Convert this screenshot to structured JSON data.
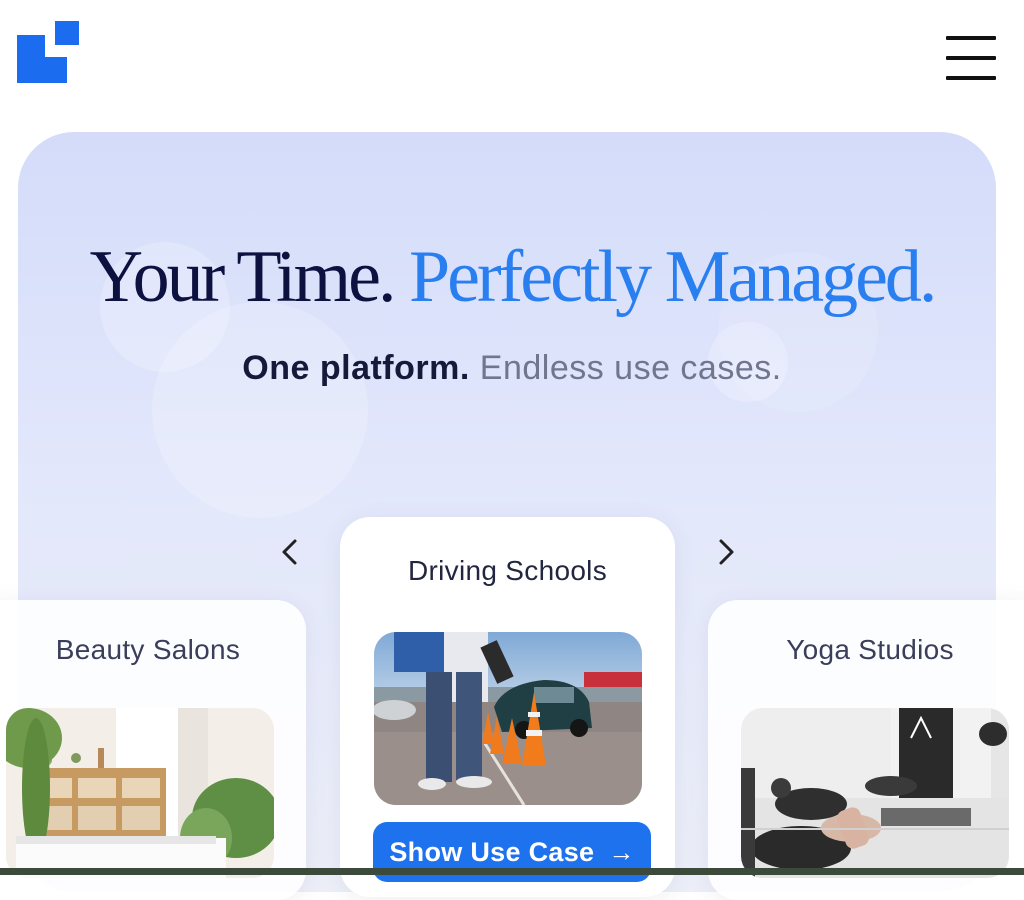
{
  "header": {
    "logo": "logo-icon",
    "menu": "hamburger-menu-icon"
  },
  "hero": {
    "headline_dark": "Your Time.",
    "headline_blue": "Perfectly Managed.",
    "subline_dark": "One platform.",
    "subline_muted": "Endless use cases."
  },
  "carousel": {
    "prev_icon": "chevron-left-icon",
    "next_icon": "chevron-right-icon",
    "cards": [
      {
        "title": "Beauty Salons"
      },
      {
        "title": "Driving Schools"
      },
      {
        "title": "Yoga Studios"
      }
    ],
    "cta_label": "Show Use Case",
    "cta_arrow": "→"
  },
  "colors": {
    "brand_blue": "#1e72ee",
    "headline_blue": "#2a7ff0",
    "headline_dark": "#0d1140",
    "hero_bg": "#d4dcfa"
  }
}
